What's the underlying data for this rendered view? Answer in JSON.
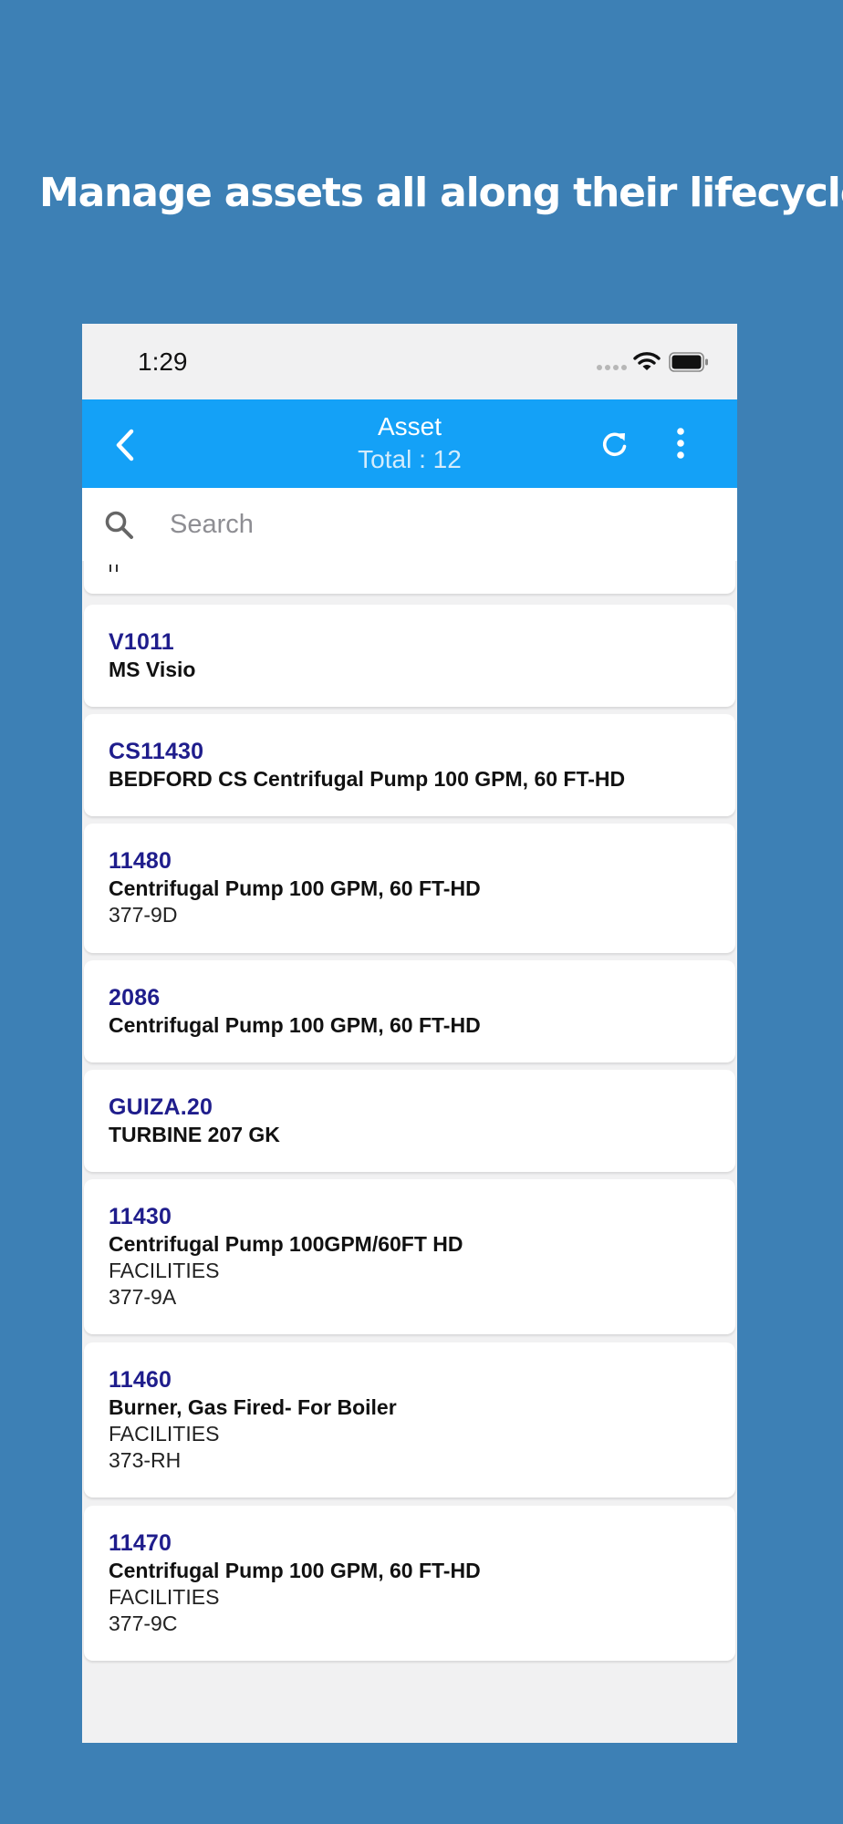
{
  "headline": "Manage assets all along their lifecycle",
  "status_bar": {
    "time": "1:29",
    "icons": [
      "signal-icon",
      "wifi-icon",
      "battery-icon"
    ]
  },
  "header": {
    "title": "Asset",
    "subtitle": "Total : 12",
    "icons": [
      "back-icon",
      "refresh-icon",
      "more-icon"
    ],
    "background_color": "#14a1f7"
  },
  "search": {
    "placeholder": "Search",
    "value": ""
  },
  "colors": {
    "page_background": "#3d80b5",
    "asset_code": "#1f1d8c"
  },
  "assets": [
    {
      "code": "V1011",
      "name": "MS Visio",
      "lines": []
    },
    {
      "code": "CS11430",
      "name": "BEDFORD CS Centrifugal Pump 100 GPM, 60 FT-HD",
      "lines": []
    },
    {
      "code": "11480",
      "name": "Centrifugal Pump 100 GPM, 60 FT-HD",
      "lines": [
        "377-9D"
      ]
    },
    {
      "code": "2086",
      "name": "Centrifugal Pump 100 GPM, 60 FT-HD",
      "lines": []
    },
    {
      "code": "GUIZA.20",
      "name": "TURBINE 207 GK",
      "lines": []
    },
    {
      "code": "11430",
      "name": "Centrifugal Pump 100GPM/60FT HD",
      "lines": [
        "FACILITIES",
        "377-9A"
      ]
    },
    {
      "code": "11460",
      "name": "Burner, Gas Fired- For Boiler",
      "lines": [
        "FACILITIES",
        "373-RH"
      ]
    },
    {
      "code": "11470",
      "name": "Centrifugal Pump 100 GPM, 60 FT-HD",
      "lines": [
        "FACILITIES",
        "377-9C"
      ]
    }
  ]
}
